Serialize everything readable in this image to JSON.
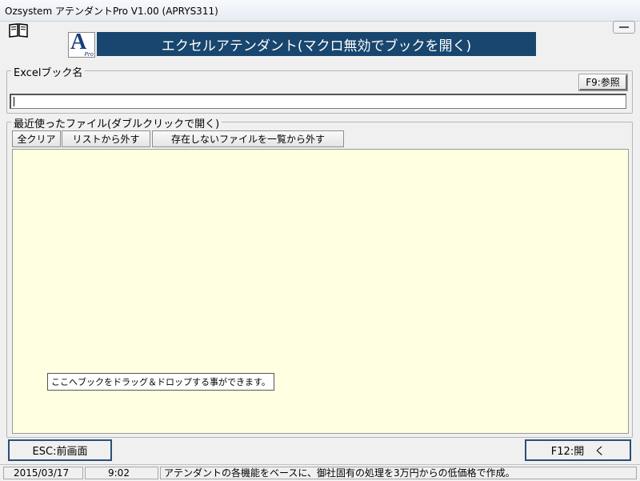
{
  "window": {
    "title": "Ozsystem アテンダントPro V1.00 (APRYS311)"
  },
  "header": {
    "logo_letter": "A",
    "logo_sub": "Pro",
    "banner": "エクセルアテンダント(マクロ無効でブックを開く)"
  },
  "excel_group": {
    "label": "Excelブック名",
    "browse_button": "F9:参照",
    "path_value": ""
  },
  "recent_group": {
    "label": "最近使ったファイル(ダブルクリックで開く)",
    "toolbar": [
      "全クリア",
      "リストから外す",
      "存在しないファイルを一覧から外す"
    ],
    "tooltip": "ここへブックをドラッグ＆ドロップする事ができます。"
  },
  "footer": {
    "esc_button": "ESC:前画面",
    "open_button": "F12:開　く"
  },
  "status": {
    "date": "2015/03/17",
    "time": "9:02",
    "message": "アテンダントの各機能をベースに、御社固有の処理を3万円からの低価格で作成。"
  },
  "colors": {
    "banner": "#18466e",
    "drop_area": "#ffffe1",
    "button_border": "#2b4f78"
  }
}
